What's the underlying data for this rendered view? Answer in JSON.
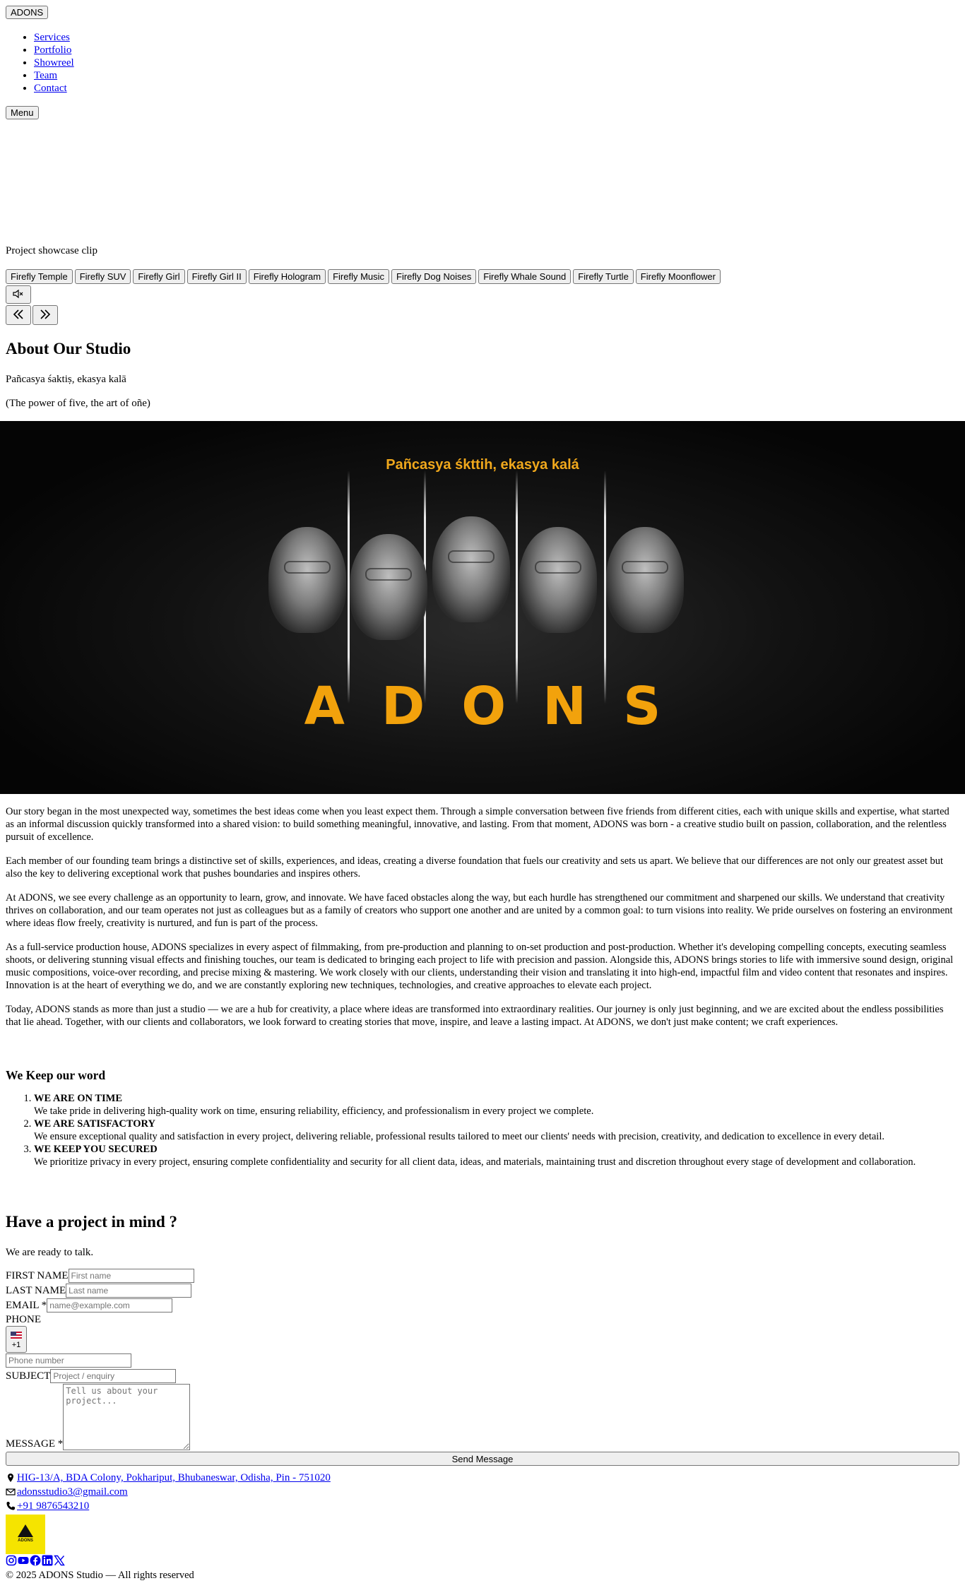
{
  "header": {
    "brand": "ADONS",
    "nav": [
      "Services",
      "Portfolio",
      "Showreel",
      "Team",
      "Contact"
    ],
    "menu_label": "Menu"
  },
  "showcase": {
    "caption": "Project showcase clip",
    "clips": [
      "Firefly Temple",
      "Firefly SUV",
      "Firefly Girl",
      "Firefly Girl II",
      "Firefly Hologram",
      "Firefly Music",
      "Firefly Dog Noises",
      "Firefly Whale Sound",
      "Firefly Turtle",
      "Firefly Moonflower"
    ],
    "mute_icon": "speaker-muted-icon",
    "prev_icon": "double-chevron-left-icon",
    "next_icon": "double-chevron-right-icon"
  },
  "about": {
    "title": "About Our Studio",
    "motto": "Pañcasya śaktiṣ, ekasya kalā",
    "motto_translation": "(The power of five, the art of oñe)",
    "hero_slogan": "Pañcasya śkttih, ekasya kalá",
    "hero_word": "ADONS",
    "paragraphs": [
      "Our story began in the most unexpected way, sometimes the best ideas come when you least expect them. Through a simple conversation between five friends from different cities, each with unique skills and expertise, what started as an informal discussion quickly transformed into a shared vision: to build something meaningful, innovative, and lasting. From that moment, ADONS was born - a creative studio built on passion, collaboration, and the relentless pursuit of excellence.",
      "Each member of our founding team brings a distinctive set of skills, experiences, and ideas, creating a diverse foundation that fuels our creativity and sets us apart. We believe that our differences are not only our greatest asset but also the key to delivering exceptional work that pushes boundaries and inspires others.",
      "At ADONS, we see every challenge as an opportunity to learn, grow, and innovate. We have faced obstacles along the way, but each hurdle has strengthened our commitment and sharpened our skills. We understand that creativity thrives on collaboration, and our team operates not just as colleagues but as a family of creators who support one another and are united by a common goal: to turn visions into reality. We pride ourselves on fostering an environment where ideas flow freely, creativity is nurtured, and fun is part of the process.",
      "As a full-service production house, ADONS specializes in every aspect of filmmaking, from pre-production and planning to on-set production and post-production. Whether it's developing compelling concepts, executing seamless shoots, or delivering stunning visual effects and finishing touches, our team is dedicated to bringing each project to life with precision and passion. Alongside this, ADONS brings stories to life with immersive sound design, original music compositions, voice-over recording, and precise mixing & mastering. We work closely with our clients, understanding their vision and translating it into high-end, impactful film and video content that resonates and inspires. Innovation is at the heart of everything we do, and we are constantly exploring new techniques, technologies, and creative approaches to elevate each project.",
      "Today, ADONS stands as more than just a studio — we are a hub for creativity, a place where ideas are transformed into extraordinary realities. Our journey is only just beginning, and we are excited about the endless possibilities that lie ahead. Together, with our clients and collaborators, we look forward to creating stories that move, inspire, and leave a lasting impact. At ADONS, we don't just make content; we craft experiences."
    ]
  },
  "promises": {
    "title": "We Keep our word",
    "items": [
      {
        "heading": "WE ARE ON TIME",
        "text": "We take pride in delivering high-quality work on time, ensuring reliability, efficiency, and professionalism in every project we complete."
      },
      {
        "heading": "WE ARE SATISFACTORY",
        "text": "We ensure exceptional quality and satisfaction in every project, delivering reliable, professional results tailored to meet our clients' needs with precision, creativity, and dedication to excellence in every detail."
      },
      {
        "heading": "WE KEEP YOU SECURED",
        "text": "We prioritize privacy in every project, ensuring complete confidentiality and security for all client data, ideas, and materials, maintaining trust and discretion throughout every stage of development and collaboration."
      }
    ]
  },
  "contact": {
    "title": "Have a project in mind ?",
    "subtitle": "We are ready to talk.",
    "first_name_label": "FIRST NAME",
    "first_name_placeholder": "First name",
    "last_name_label": "LAST NAME",
    "last_name_placeholder": "Last name",
    "email_label": "EMAIL *",
    "email_placeholder": "name@example.com",
    "phone_label": "PHONE",
    "country_code": "+1",
    "phone_placeholder": "Phone number",
    "subject_label": "SUBJECT",
    "subject_placeholder": "Project / enquiry",
    "message_label": "MESSAGE *",
    "message_placeholder": "Tell us about your project...",
    "submit_label": "Send Message"
  },
  "footer": {
    "address": "HIG-13/A, BDA Colony, Pokhariput, Bhubaneswar, Odisha, Pin - 751020",
    "email": "adonsstudio3@gmail.com",
    "phone": "+91 9876543210",
    "logo_text": "ADONS",
    "socials": [
      "instagram-icon",
      "youtube-icon",
      "facebook-icon",
      "linkedin-icon",
      "x-icon"
    ],
    "copyright": "© 2025 ADONS Studio — All rights reserved",
    "logo_color": "#f5e400"
  },
  "colors": {
    "accent": "#f2a20c",
    "link": "#0000ee"
  }
}
